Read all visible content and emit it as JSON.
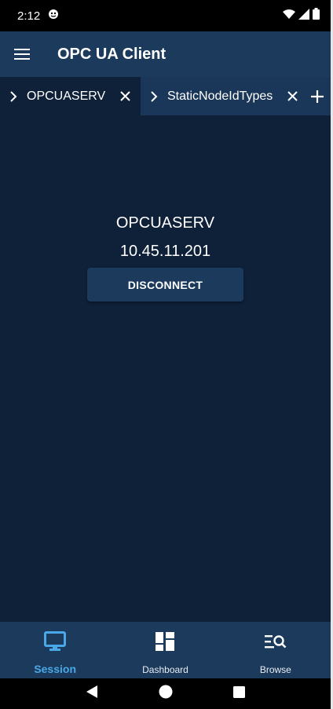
{
  "status_bar": {
    "time": "2:12"
  },
  "app_bar": {
    "title": "OPC UA Client"
  },
  "tabs": [
    {
      "label": "OPCUASERV",
      "active": true
    },
    {
      "label": "StaticNodeIdTypes",
      "active": false
    }
  ],
  "session": {
    "server_name": "OPCUASERV",
    "server_address": "10.45.11.201",
    "disconnect_label": "DISCONNECT"
  },
  "bottom_nav": {
    "items": [
      {
        "label": "Session",
        "icon": "monitor-icon",
        "active": true
      },
      {
        "label": "Dashboard",
        "icon": "dashboard-icon",
        "active": false
      },
      {
        "label": "Browse",
        "icon": "browse-search-icon",
        "active": false
      }
    ]
  },
  "colors": {
    "app_bar": "#1b3a5c",
    "background": "#0f2039",
    "accent": "#4aa8e8"
  }
}
